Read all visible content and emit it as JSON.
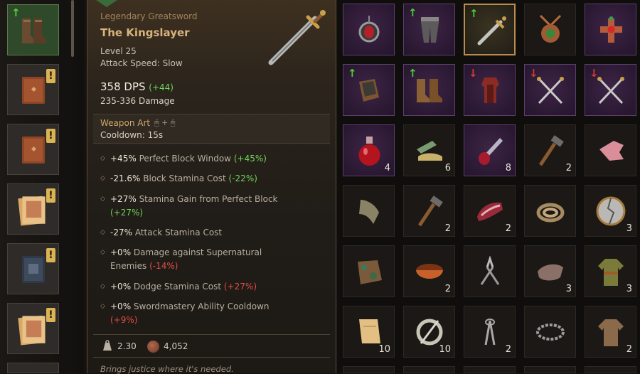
{
  "left_items": [
    {
      "name": "boots",
      "indicator": "up"
    },
    {
      "name": "book-brown",
      "indicator": "new"
    },
    {
      "name": "book-brown",
      "indicator": "new"
    },
    {
      "name": "scroll",
      "indicator": "new"
    },
    {
      "name": "book-blue",
      "indicator": "new"
    },
    {
      "name": "scroll",
      "indicator": "new"
    }
  ],
  "tooltip": {
    "rarity": "Legendary Greatsword",
    "name": "The Kingslayer",
    "level": "Level 25",
    "attack_speed": "Attack Speed: Slow",
    "dps": "358 DPS",
    "dps_delta": "(+44)",
    "damage": "235-336 Damage",
    "weapon_art_label": "Weapon Art",
    "weapon_art_keys": "🖱 + 🖱",
    "cooldown": "Cooldown: 15s",
    "stats": [
      {
        "value": "+45%",
        "label": "Perfect Block Window",
        "delta": "(+45%)",
        "sign": "pos"
      },
      {
        "value": "-21.6%",
        "label": "Block Stamina Cost",
        "delta": "(-22%)",
        "sign": "pos"
      },
      {
        "value": "+27%",
        "label": "Stamina Gain from Perfect Block",
        "delta": "(+27%)",
        "sign": "pos"
      },
      {
        "value": "-27%",
        "label": "Attack Stamina Cost",
        "delta": "",
        "sign": "pos"
      },
      {
        "value": "+0%",
        "label": "Damage against Supernatural Enemies",
        "delta": "(-14%)",
        "sign": "neg"
      },
      {
        "value": "+0%",
        "label": "Dodge Stamina Cost",
        "delta": "(+27%)",
        "sign": "neg"
      },
      {
        "value": "+0%",
        "label": "Swordmastery Ability Cooldown",
        "delta": "(+9%)",
        "sign": "neg"
      }
    ],
    "weight": "2.30",
    "price": "4,052",
    "flavor": "Brings justice where it's needed."
  },
  "grid": [
    {
      "icon": "amulet-red",
      "bg": "purple",
      "indicator": "",
      "count": ""
    },
    {
      "icon": "leg-armor",
      "bg": "purple",
      "indicator": "up",
      "count": ""
    },
    {
      "icon": "greatsword",
      "bg": "selected",
      "indicator": "up",
      "count": ""
    },
    {
      "icon": "amulet-green",
      "bg": "dark",
      "indicator": "",
      "count": ""
    },
    {
      "icon": "cross-pendant",
      "bg": "purple",
      "indicator": "",
      "count": ""
    },
    {
      "icon": "bracers",
      "bg": "purple",
      "indicator": "up",
      "count": ""
    },
    {
      "icon": "boots",
      "bg": "purple",
      "indicator": "up",
      "count": ""
    },
    {
      "icon": "red-armor",
      "bg": "purple",
      "indicator": "down",
      "count": ""
    },
    {
      "icon": "crossed-swords",
      "bg": "purple",
      "indicator": "down",
      "count": ""
    },
    {
      "icon": "crossed-swords",
      "bg": "purple",
      "indicator": "down",
      "count": ""
    },
    {
      "icon": "red-potion",
      "bg": "purple",
      "indicator": "",
      "count": "4"
    },
    {
      "icon": "green-bottle",
      "bg": "dark",
      "indicator": "",
      "count": "6"
    },
    {
      "icon": "dagger-potion",
      "bg": "purple",
      "indicator": "",
      "count": "8"
    },
    {
      "icon": "hammer",
      "bg": "dark",
      "indicator": "",
      "count": "2"
    },
    {
      "icon": "meat",
      "bg": "dark",
      "indicator": "",
      "count": ""
    },
    {
      "icon": "cloth",
      "bg": "dark",
      "indicator": "",
      "count": ""
    },
    {
      "icon": "hammer",
      "bg": "dark",
      "indicator": "",
      "count": "2"
    },
    {
      "icon": "meat-raw",
      "bg": "dark",
      "indicator": "",
      "count": "2"
    },
    {
      "icon": "rope",
      "bg": "dark",
      "indicator": "",
      "count": ""
    },
    {
      "icon": "shield-broken",
      "bg": "dark",
      "indicator": "",
      "count": "3"
    },
    {
      "icon": "ore",
      "bg": "dark",
      "indicator": "",
      "count": ""
    },
    {
      "icon": "bowl",
      "bg": "dark",
      "indicator": "",
      "count": "2"
    },
    {
      "icon": "pliers",
      "bg": "dark",
      "indicator": "",
      "count": ""
    },
    {
      "icon": "pelt",
      "bg": "dark",
      "indicator": "",
      "count": "3"
    },
    {
      "icon": "tunic-green",
      "bg": "dark",
      "indicator": "",
      "count": "3"
    },
    {
      "icon": "parchment",
      "bg": "dark",
      "indicator": "",
      "count": "10"
    },
    {
      "icon": "brooch",
      "bg": "dark",
      "indicator": "",
      "count": "10"
    },
    {
      "icon": "shears",
      "bg": "dark",
      "indicator": "",
      "count": "2"
    },
    {
      "icon": "chain",
      "bg": "dark",
      "indicator": "",
      "count": ""
    },
    {
      "icon": "tunic-brown",
      "bg": "dark",
      "indicator": "",
      "count": "2"
    }
  ]
}
